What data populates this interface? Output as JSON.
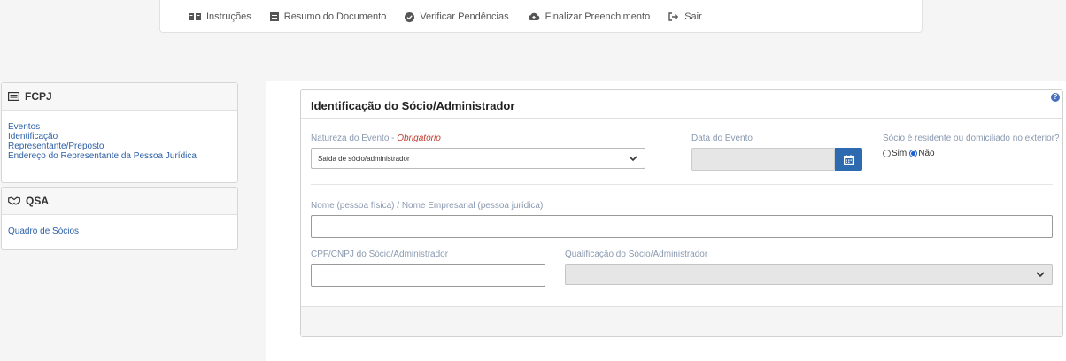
{
  "topnav": {
    "items": [
      {
        "label": "Instruções",
        "icon": "book-icon"
      },
      {
        "label": "Resumo do Documento",
        "icon": "list-icon"
      },
      {
        "label": "Verificar Pendências",
        "icon": "check-circle-icon"
      },
      {
        "label": "Finalizar Preenchimento",
        "icon": "cloud-upload-icon"
      },
      {
        "label": "Sair",
        "icon": "sign-out-icon"
      }
    ]
  },
  "sidebar": {
    "fcpj": {
      "title": "FCPJ",
      "links": [
        "Eventos",
        "Identificação",
        "Representante/Preposto",
        "Endereço do Representante da Pessoa Jurídica"
      ]
    },
    "qsa": {
      "title": "QSA",
      "links": [
        "Quadro de Sócios"
      ]
    }
  },
  "form": {
    "title": "Identificação do Sócio/Administrador",
    "help": "?",
    "natureza": {
      "label": "Natureza do Evento - ",
      "required": "Obrigatório",
      "value": "Saída de sócio/administrador"
    },
    "data_evento": {
      "label": "Data do Evento",
      "value": ""
    },
    "residente": {
      "label": "Sócio é residente ou domiciliado no exterior?",
      "options": [
        "Sim",
        "Não"
      ],
      "selected": "Não"
    },
    "nome": {
      "label": "Nome (pessoa física) / Nome Empresarial (pessoa jurídica)",
      "value": ""
    },
    "cpf": {
      "label": "CPF/CNPJ do Sócio/Administrador",
      "value": ""
    },
    "qualificacao": {
      "label": "Qualificação do Sócio/Administrador",
      "value": ""
    }
  },
  "colors": {
    "accent": "#2d6ab0",
    "link": "#2b5fa6",
    "required": "#c0392b",
    "label": "#8a99b0"
  }
}
